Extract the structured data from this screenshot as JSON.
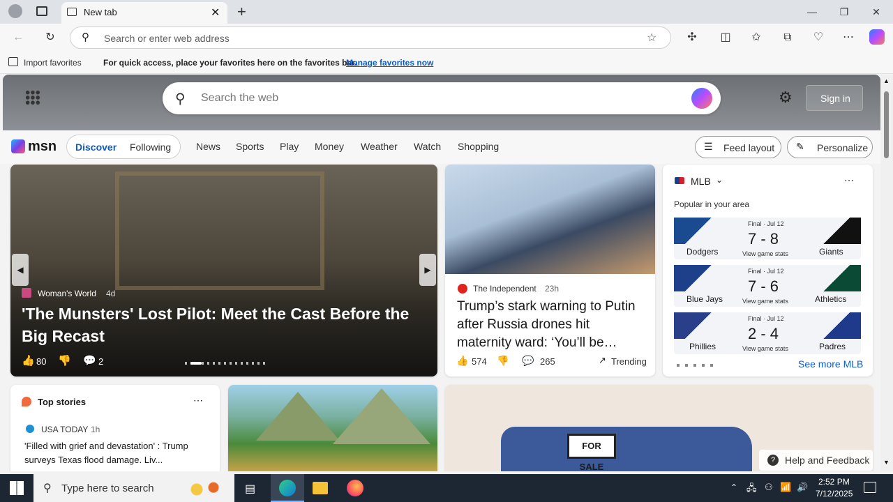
{
  "browser": {
    "tab_title": "New tab",
    "address_placeholder": "Search or enter web address",
    "import_favorites": "Import favorites",
    "favbar_text": "For quick access, place your favorites here on the favorites bar.",
    "favbar_link": "Manage favorites now"
  },
  "msn": {
    "search_placeholder": "Search the web",
    "sign_in": "Sign in",
    "logo": "msn",
    "tabs": [
      "Discover",
      "Following"
    ],
    "nav": [
      "News",
      "Sports",
      "Play",
      "Money",
      "Weather",
      "Watch",
      "Shopping"
    ],
    "feed_layout": "Feed layout",
    "personalize": "Personalize"
  },
  "hero_story": {
    "source": "Woman's World",
    "age": "4d",
    "title": "'The Munsters' Lost Pilot: Meet the Cast Before the Big Recast",
    "likes": "80",
    "comments": "2"
  },
  "story2": {
    "source": "The Independent",
    "age": "23h",
    "title": "Trump’s stark warning to Putin after Russia drones hit maternity ward: ‘You’ll be…",
    "likes": "574",
    "comments": "265",
    "trending": "Trending"
  },
  "mlb": {
    "title": "MLB",
    "subtitle": "Popular in your area",
    "games": [
      {
        "status": "Final · Jul 12",
        "score": "7 - 8",
        "home": "Dodgers",
        "away": "Giants",
        "view": "View game stats"
      },
      {
        "status": "Final · Jul 12",
        "score": "7 - 6",
        "home": "Blue Jays",
        "away": "Athletics",
        "view": "View game stats"
      },
      {
        "status": "Final · Jul 12",
        "score": "2 - 4",
        "home": "Phillies",
        "away": "Padres",
        "view": "View game stats"
      }
    ],
    "see_more": "See more MLB"
  },
  "top_stories": {
    "title": "Top stories",
    "source": "USA TODAY",
    "age": "1h",
    "headline": "'Filled with grief and devastation' : Trump surveys Texas flood damage. Liv..."
  },
  "help": "Help and Feedback",
  "taskbar": {
    "search_placeholder": "Type here to search",
    "time": "2:52 PM",
    "date": "7/12/2025"
  }
}
